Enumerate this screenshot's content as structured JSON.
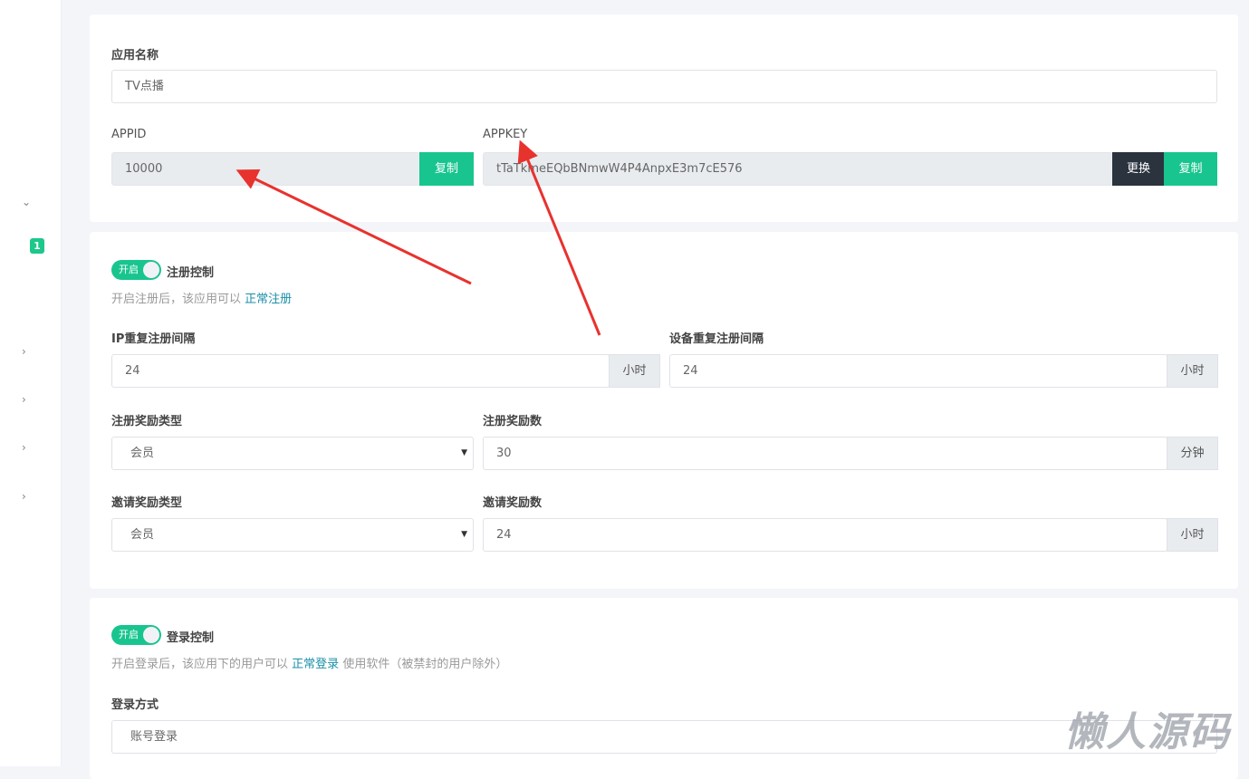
{
  "sidebar": {
    "badge": "1"
  },
  "app": {
    "name_label": "应用名称",
    "name_value": "TV点播",
    "appid_label": "APPID",
    "appid_value": "10000",
    "appkey_label": "APPKEY",
    "appkey_value": "tTaTkmeEQbBNmwW4P4AnpxE3m7cE576",
    "copy_label": "复制",
    "change_label": "更换"
  },
  "register": {
    "toggle_label": "开启",
    "title": "注册控制",
    "desc_prefix": "开启注册后，该应用可以",
    "desc_link": "正常注册",
    "ip_label": "IP重复注册间隔",
    "ip_value": "24",
    "ip_unit": "小时",
    "device_label": "设备重复注册间隔",
    "device_value": "24",
    "device_unit": "小时",
    "reward_type_label": "注册奖励类型",
    "reward_type_value": "会员",
    "reward_num_label": "注册奖励数",
    "reward_num_value": "30",
    "reward_num_unit": "分钟",
    "invite_type_label": "邀请奖励类型",
    "invite_type_value": "会员",
    "invite_num_label": "邀请奖励数",
    "invite_num_value": "24",
    "invite_num_unit": "小时"
  },
  "login": {
    "toggle_label": "开启",
    "title": "登录控制",
    "desc_prefix": "开启登录后，该应用下的用户可以",
    "desc_link": "正常登录",
    "desc_suffix": "使用软件（被禁封的用户除外）",
    "method_label": "登录方式",
    "method_value": "账号登录"
  },
  "watermark": "懒人源码"
}
